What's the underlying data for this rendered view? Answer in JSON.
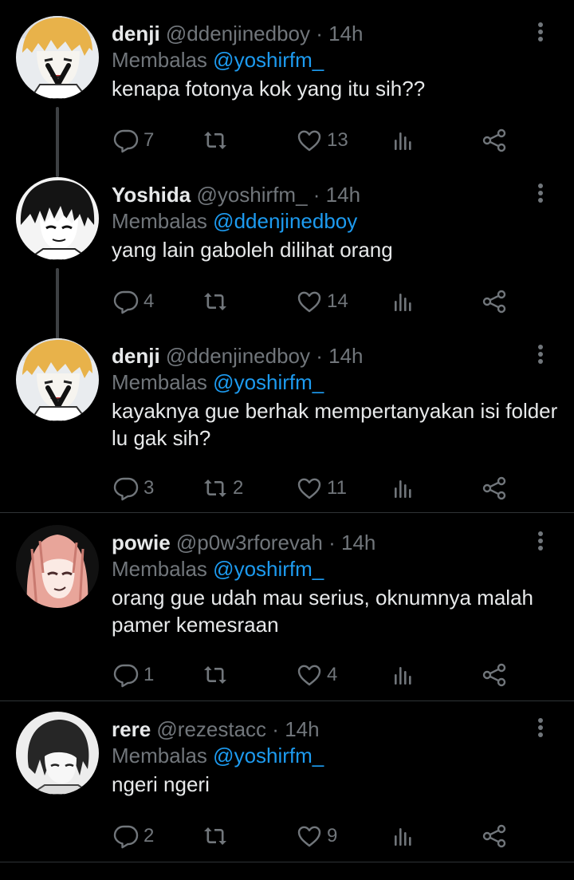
{
  "colors": {
    "background": "#000000",
    "text": "#e7e9ea",
    "muted": "#71767b",
    "accent": "#1d9bf0",
    "divider": "#2f3336"
  },
  "tweets": [
    {
      "name": "denji",
      "handle": "@ddenjinedboy",
      "dot": "·",
      "time": "14h",
      "reply_prefix": "Membalas",
      "reply_to": "@yoshirfm_",
      "text": "kenapa fotonya kok yang itu sih??",
      "replies": "7",
      "retweets": "",
      "likes": "13",
      "avatar_icon": "avatar-denji"
    },
    {
      "name": "Yoshida",
      "handle": "@yoshirfm_",
      "dot": "·",
      "time": "14h",
      "reply_prefix": "Membalas",
      "reply_to": "@ddenjinedboy",
      "text": "yang lain gaboleh dilihat orang",
      "replies": "4",
      "retweets": "",
      "likes": "14",
      "avatar_icon": "avatar-yoshida"
    },
    {
      "name": "denji",
      "handle": "@ddenjinedboy",
      "dot": "·",
      "time": "14h",
      "reply_prefix": "Membalas",
      "reply_to": "@yoshirfm_",
      "text": "kayaknya gue berhak mempertanyakan isi folder lu gak sih?",
      "replies": "3",
      "retweets": "2",
      "likes": "11",
      "avatar_icon": "avatar-denji"
    },
    {
      "name": "powie",
      "handle": "@p0w3rforevah",
      "dot": "·",
      "time": "14h",
      "reply_prefix": "Membalas",
      "reply_to": "@yoshirfm_",
      "text": "orang gue udah mau serius, oknumnya malah pamer kemesraan",
      "replies": "1",
      "retweets": "",
      "likes": "4",
      "avatar_icon": "avatar-powie"
    },
    {
      "name": "rere",
      "handle": "@rezestacc",
      "dot": "·",
      "time": "14h",
      "reply_prefix": "Membalas",
      "reply_to": "@yoshirfm_",
      "text": "ngeri ngeri",
      "replies": "2",
      "retweets": "",
      "likes": "9",
      "avatar_icon": "avatar-rere"
    }
  ],
  "icons": [
    "more-icon",
    "reply-icon",
    "retweet-icon",
    "like-icon",
    "views-icon",
    "share-icon"
  ]
}
